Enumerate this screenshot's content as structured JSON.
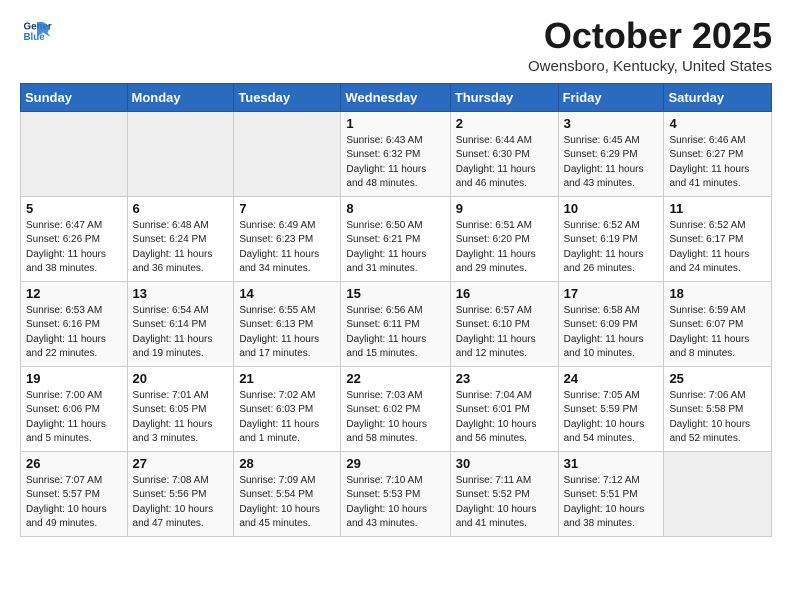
{
  "logo": {
    "line1": "General",
    "line2": "Blue"
  },
  "title": "October 2025",
  "subtitle": "Owensboro, Kentucky, United States",
  "weekdays": [
    "Sunday",
    "Monday",
    "Tuesday",
    "Wednesday",
    "Thursday",
    "Friday",
    "Saturday"
  ],
  "weeks": [
    [
      {
        "day": "",
        "info": ""
      },
      {
        "day": "",
        "info": ""
      },
      {
        "day": "",
        "info": ""
      },
      {
        "day": "1",
        "info": "Sunrise: 6:43 AM\nSunset: 6:32 PM\nDaylight: 11 hours\nand 48 minutes."
      },
      {
        "day": "2",
        "info": "Sunrise: 6:44 AM\nSunset: 6:30 PM\nDaylight: 11 hours\nand 46 minutes."
      },
      {
        "day": "3",
        "info": "Sunrise: 6:45 AM\nSunset: 6:29 PM\nDaylight: 11 hours\nand 43 minutes."
      },
      {
        "day": "4",
        "info": "Sunrise: 6:46 AM\nSunset: 6:27 PM\nDaylight: 11 hours\nand 41 minutes."
      }
    ],
    [
      {
        "day": "5",
        "info": "Sunrise: 6:47 AM\nSunset: 6:26 PM\nDaylight: 11 hours\nand 38 minutes."
      },
      {
        "day": "6",
        "info": "Sunrise: 6:48 AM\nSunset: 6:24 PM\nDaylight: 11 hours\nand 36 minutes."
      },
      {
        "day": "7",
        "info": "Sunrise: 6:49 AM\nSunset: 6:23 PM\nDaylight: 11 hours\nand 34 minutes."
      },
      {
        "day": "8",
        "info": "Sunrise: 6:50 AM\nSunset: 6:21 PM\nDaylight: 11 hours\nand 31 minutes."
      },
      {
        "day": "9",
        "info": "Sunrise: 6:51 AM\nSunset: 6:20 PM\nDaylight: 11 hours\nand 29 minutes."
      },
      {
        "day": "10",
        "info": "Sunrise: 6:52 AM\nSunset: 6:19 PM\nDaylight: 11 hours\nand 26 minutes."
      },
      {
        "day": "11",
        "info": "Sunrise: 6:52 AM\nSunset: 6:17 PM\nDaylight: 11 hours\nand 24 minutes."
      }
    ],
    [
      {
        "day": "12",
        "info": "Sunrise: 6:53 AM\nSunset: 6:16 PM\nDaylight: 11 hours\nand 22 minutes."
      },
      {
        "day": "13",
        "info": "Sunrise: 6:54 AM\nSunset: 6:14 PM\nDaylight: 11 hours\nand 19 minutes."
      },
      {
        "day": "14",
        "info": "Sunrise: 6:55 AM\nSunset: 6:13 PM\nDaylight: 11 hours\nand 17 minutes."
      },
      {
        "day": "15",
        "info": "Sunrise: 6:56 AM\nSunset: 6:11 PM\nDaylight: 11 hours\nand 15 minutes."
      },
      {
        "day": "16",
        "info": "Sunrise: 6:57 AM\nSunset: 6:10 PM\nDaylight: 11 hours\nand 12 minutes."
      },
      {
        "day": "17",
        "info": "Sunrise: 6:58 AM\nSunset: 6:09 PM\nDaylight: 11 hours\nand 10 minutes."
      },
      {
        "day": "18",
        "info": "Sunrise: 6:59 AM\nSunset: 6:07 PM\nDaylight: 11 hours\nand 8 minutes."
      }
    ],
    [
      {
        "day": "19",
        "info": "Sunrise: 7:00 AM\nSunset: 6:06 PM\nDaylight: 11 hours\nand 5 minutes."
      },
      {
        "day": "20",
        "info": "Sunrise: 7:01 AM\nSunset: 6:05 PM\nDaylight: 11 hours\nand 3 minutes."
      },
      {
        "day": "21",
        "info": "Sunrise: 7:02 AM\nSunset: 6:03 PM\nDaylight: 11 hours\nand 1 minute."
      },
      {
        "day": "22",
        "info": "Sunrise: 7:03 AM\nSunset: 6:02 PM\nDaylight: 10 hours\nand 58 minutes."
      },
      {
        "day": "23",
        "info": "Sunrise: 7:04 AM\nSunset: 6:01 PM\nDaylight: 10 hours\nand 56 minutes."
      },
      {
        "day": "24",
        "info": "Sunrise: 7:05 AM\nSunset: 5:59 PM\nDaylight: 10 hours\nand 54 minutes."
      },
      {
        "day": "25",
        "info": "Sunrise: 7:06 AM\nSunset: 5:58 PM\nDaylight: 10 hours\nand 52 minutes."
      }
    ],
    [
      {
        "day": "26",
        "info": "Sunrise: 7:07 AM\nSunset: 5:57 PM\nDaylight: 10 hours\nand 49 minutes."
      },
      {
        "day": "27",
        "info": "Sunrise: 7:08 AM\nSunset: 5:56 PM\nDaylight: 10 hours\nand 47 minutes."
      },
      {
        "day": "28",
        "info": "Sunrise: 7:09 AM\nSunset: 5:54 PM\nDaylight: 10 hours\nand 45 minutes."
      },
      {
        "day": "29",
        "info": "Sunrise: 7:10 AM\nSunset: 5:53 PM\nDaylight: 10 hours\nand 43 minutes."
      },
      {
        "day": "30",
        "info": "Sunrise: 7:11 AM\nSunset: 5:52 PM\nDaylight: 10 hours\nand 41 minutes."
      },
      {
        "day": "31",
        "info": "Sunrise: 7:12 AM\nSunset: 5:51 PM\nDaylight: 10 hours\nand 38 minutes."
      },
      {
        "day": "",
        "info": ""
      }
    ]
  ]
}
